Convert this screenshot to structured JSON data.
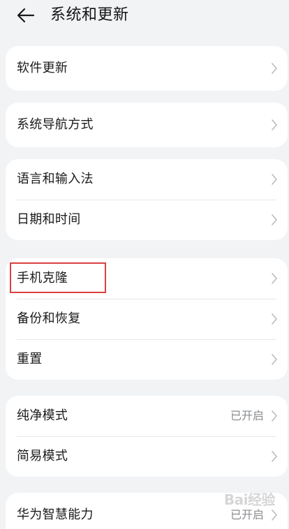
{
  "header": {
    "title": "系统和更新",
    "back_icon": "arrow-left-icon"
  },
  "groups": [
    {
      "items": [
        {
          "label": "软件更新",
          "value": ""
        }
      ]
    },
    {
      "items": [
        {
          "label": "系统导航方式",
          "value": ""
        }
      ]
    },
    {
      "items": [
        {
          "label": "语言和输入法",
          "value": ""
        },
        {
          "label": "日期和时间",
          "value": ""
        }
      ]
    },
    {
      "items": [
        {
          "label": "手机克隆",
          "value": ""
        },
        {
          "label": "备份和恢复",
          "value": ""
        },
        {
          "label": "重置",
          "value": ""
        }
      ]
    },
    {
      "items": [
        {
          "label": "纯净模式",
          "value": "已开启"
        },
        {
          "label": "简易模式",
          "value": ""
        }
      ]
    },
    {
      "items": [
        {
          "label": "华为智慧能力",
          "value": "已开启"
        }
      ]
    }
  ],
  "highlight_color": "#d94040",
  "watermark": {
    "text": "Bai经验"
  }
}
